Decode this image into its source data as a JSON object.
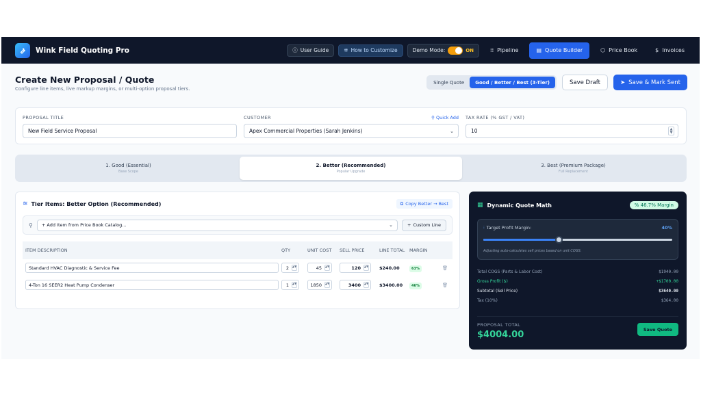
{
  "nav": {
    "brand": "Wink Field Quoting Pro",
    "user_guide": "User Guide",
    "customize": "How to Customize",
    "demo_label": "Demo Mode:",
    "demo_state": "ON",
    "links": [
      "Pipeline",
      "Quote Builder",
      "Price Book",
      "Invoices"
    ],
    "active_link": "Quote Builder"
  },
  "header": {
    "title": "Create New Proposal / Quote",
    "subtitle": "Configure line items, live markup margins, or multi-option proposal tiers.",
    "mode_single": "Single Quote",
    "mode_tiers": "Good / Better / Best (3-Tier)",
    "save_draft": "Save Draft",
    "save_sent": "Save & Mark Sent"
  },
  "form": {
    "title_label": "PROPOSAL TITLE",
    "title_value": "New Field Service Proposal",
    "customer_label": "CUSTOMER",
    "quick_add": "Quick Add",
    "customer_value": "Apex Commercial Properties (Sarah Jenkins)",
    "tax_label": "TAX RATE (% GST / VAT)",
    "tax_value": "10"
  },
  "tiers": [
    {
      "title": "1. Good (Essential)",
      "sub": "Base Scope"
    },
    {
      "title": "2. Better (Recommended)",
      "sub": "Popular Upgrade"
    },
    {
      "title": "3. Best (Premium Package)",
      "sub": "Full Replacement"
    }
  ],
  "items": {
    "title": "Tier Items: Better Option (Recommended)",
    "copy": "Copy Better → Best",
    "add_placeholder": "+ Add Item from Price Book Catalog...",
    "custom_line": "Custom Line",
    "headers": [
      "ITEM DESCRIPTION",
      "QTY",
      "UNIT COST",
      "SELL PRICE",
      "LINE TOTAL",
      "MARGIN"
    ],
    "rows": [
      {
        "desc": "Standard HVAC Diagnostic & Service Fee",
        "qty": "2",
        "unit": "45",
        "sell": "120",
        "total": "$240.00",
        "margin": "63%"
      },
      {
        "desc": "4-Ton 16 SEER2 Heat Pump Condenser",
        "qty": "1",
        "unit": "1850",
        "sell": "3400",
        "total": "$3400.00",
        "margin": "46%"
      }
    ]
  },
  "math": {
    "title": "Dynamic Quote Math",
    "badge": "46.7% Margin",
    "target_label": "Target Profit Margin:",
    "target_value": "40%",
    "target_fraction": 0.4,
    "note": "Adjusting auto-calculates sell prices based on unit COGS.",
    "cogs_label": "Total COGS (Parts & Labor Cost)",
    "cogs_value": "$1940.00",
    "profit_label": "Gross Profit ($)",
    "profit_value": "+$1700.00",
    "subtotal_label": "Subtotal (Sell Price)",
    "subtotal_value": "$3640.00",
    "tax_label": "Tax (10%)",
    "tax_value": "$364.00",
    "total_label": "PROPOSAL TOTAL",
    "total_value": "$4004.00",
    "save_quote": "Save Quote"
  }
}
